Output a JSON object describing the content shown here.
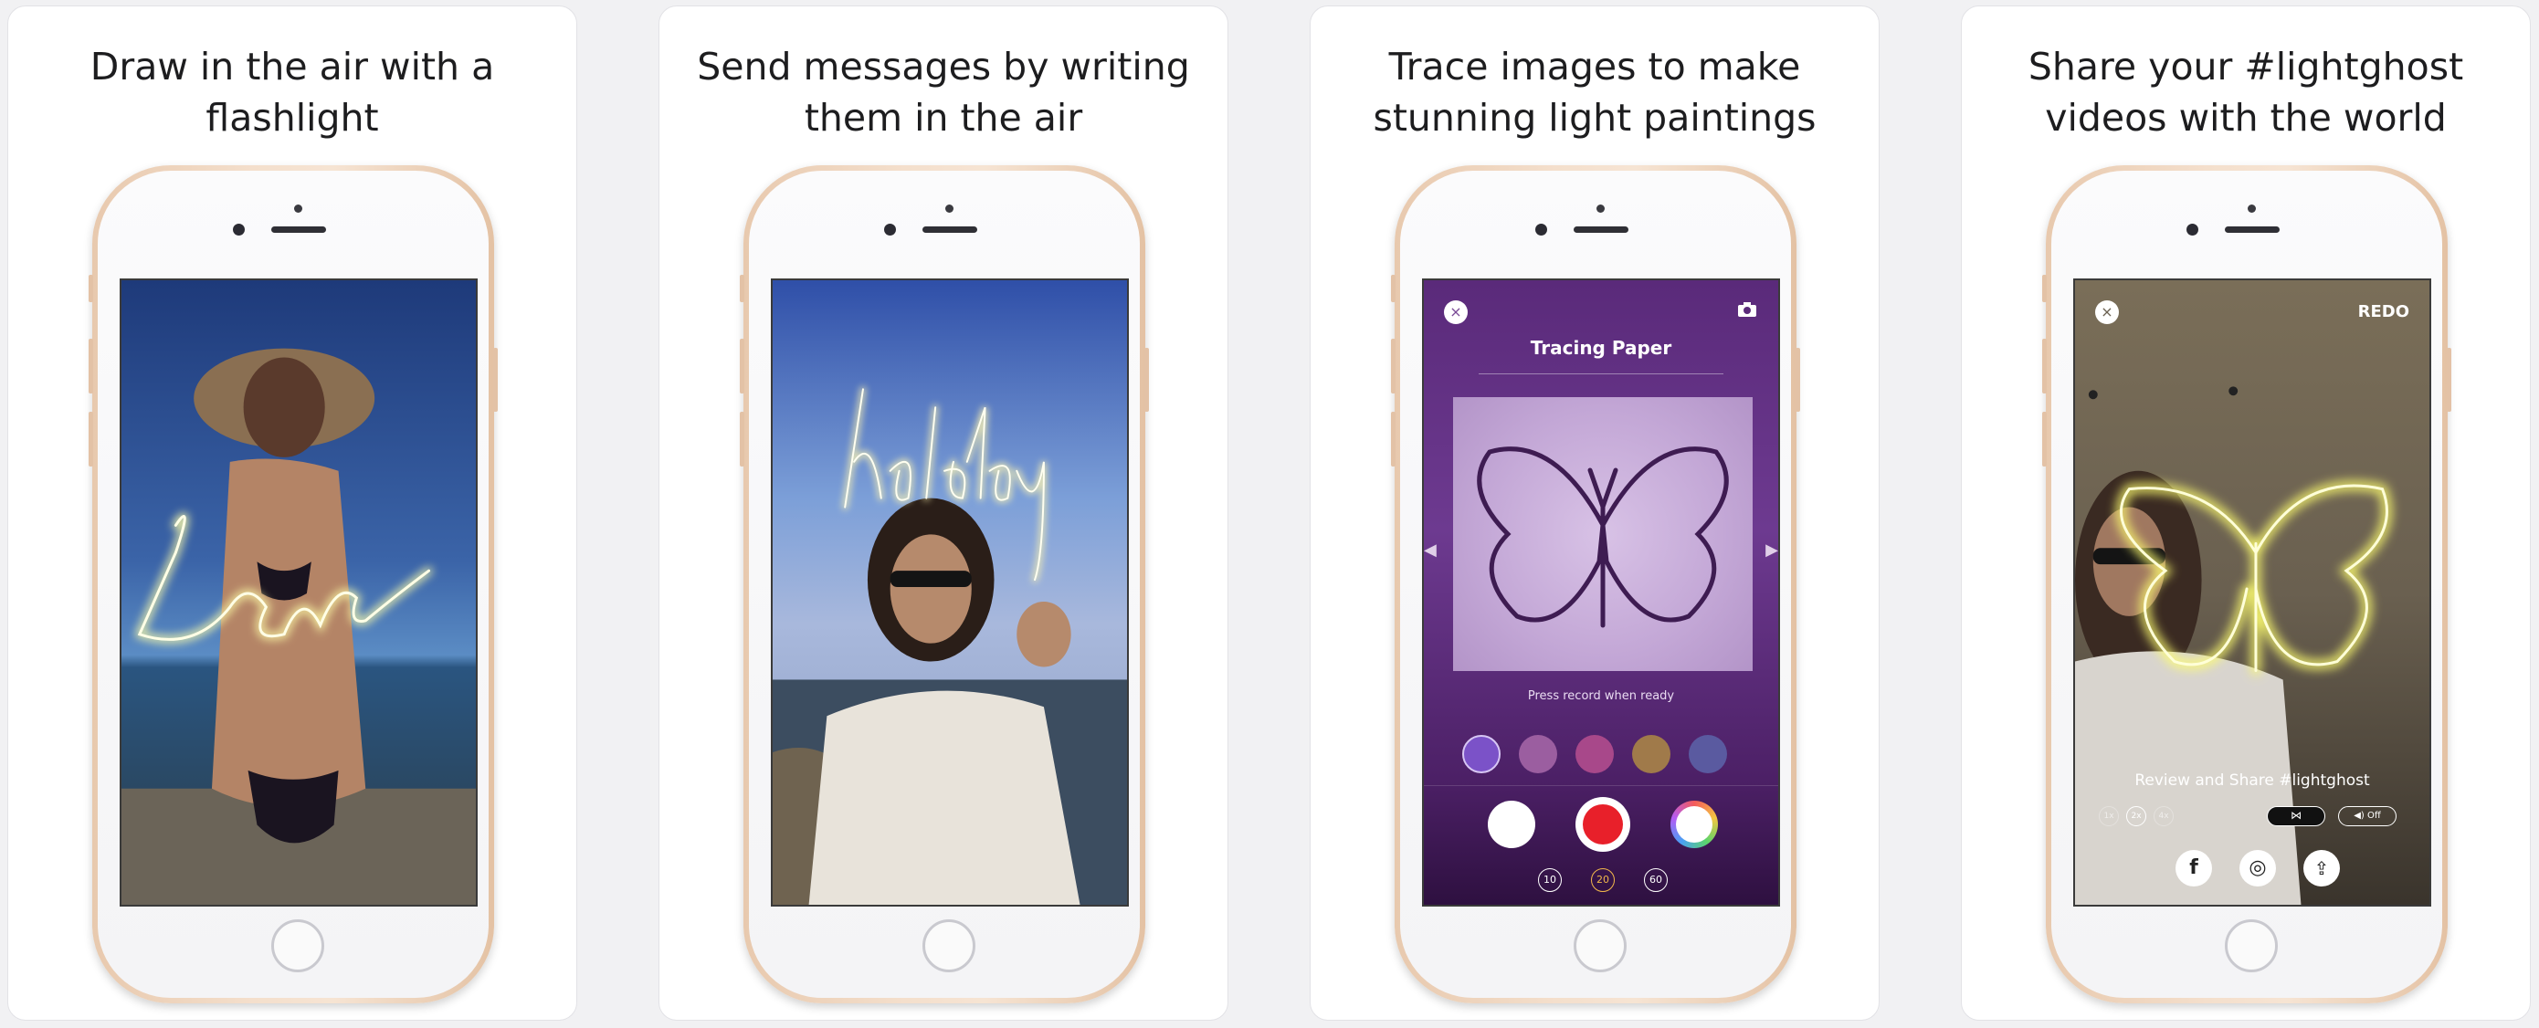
{
  "panels": [
    {
      "caption": "Draw in the air with a flashlight"
    },
    {
      "caption": "Send messages by writing them in the air"
    },
    {
      "caption": "Trace images to make stunning light paintings"
    },
    {
      "caption": "Share your #lightghost videos with the world"
    }
  ],
  "screen1": {
    "light_text": "Love"
  },
  "screen2": {
    "light_text": "holiday"
  },
  "screen3": {
    "close_icon": "×",
    "camera_icon": "camera-icon",
    "title": "Tracing Paper",
    "hint": "Press record when ready",
    "timers": [
      "10",
      "20",
      "60"
    ],
    "selected_timer": "20",
    "accent": "#f2b84b"
  },
  "screen4": {
    "close_icon": "×",
    "redo_label": "REDO",
    "review_text": "Review and Share #lightghost",
    "speeds": [
      "1x",
      "2x",
      "4x"
    ],
    "sound_label": "◀) Off",
    "share_icons": [
      "facebook-icon",
      "instagram-icon",
      "share-icon"
    ],
    "facebook_glyph": "f",
    "instagram_glyph": "◎",
    "share_glyph": "⇪"
  }
}
